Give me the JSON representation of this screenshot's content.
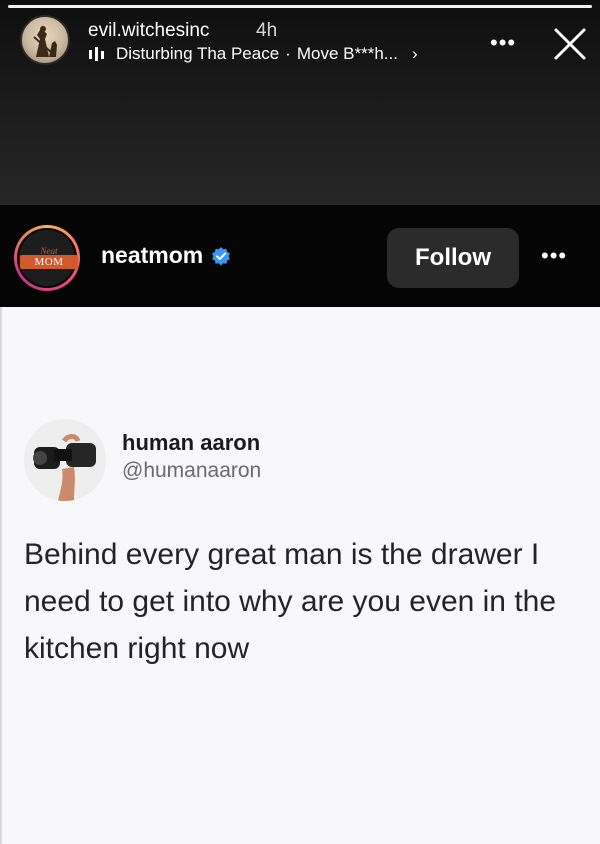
{
  "story": {
    "username": "evil.witchesinc",
    "time": "4h",
    "music_artist": "Disturbing Tha Peace",
    "music_separator": "·",
    "music_title": "Move B***h...",
    "music_chevron": "›",
    "more_label": "•••",
    "progress_fraction": 1.0
  },
  "post": {
    "username": "neatmom",
    "avatar_text_top": "Neat",
    "avatar_text_bottom": "MOM",
    "follow_label": "Follow",
    "more_label": "•••",
    "verified_color": "#3897f0"
  },
  "tweet": {
    "name": "human aaron",
    "handle": "@humanaaron",
    "text": "Behind every great man is the drawer I need to get into why are you even in the kitchen right now"
  },
  "icons": {
    "avatar": "witch-silhouette-icon",
    "music": "music-bars-icon",
    "close": "close-icon",
    "verified": "verified-badge-icon",
    "tweet_avatar": "binoculars-icon"
  }
}
